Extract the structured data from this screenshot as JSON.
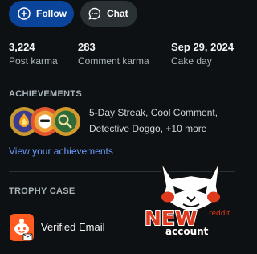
{
  "actions": {
    "follow_label": "Follow",
    "chat_label": "Chat"
  },
  "stats": [
    {
      "value": "3,224",
      "label": "Post karma"
    },
    {
      "value": "283",
      "label": "Comment karma"
    },
    {
      "value": "Sep 29, 2024",
      "label": "Cake day"
    }
  ],
  "achievements": {
    "title": "ACHIEVEMENTS",
    "summary_line1": "5-Day Streak, Cool Comment,",
    "summary_line2": "Detective Doggo, +10 more",
    "link_label": "View your achievements",
    "badge_names": [
      "5-day-streak",
      "cool-comment",
      "detective-doggo"
    ]
  },
  "trophy_case": {
    "title": "TROPHY CASE",
    "items": [
      {
        "label": "Verified Email",
        "icon": "verified-email-trophy-icon"
      }
    ]
  },
  "overlay": {
    "text_main": "NEW",
    "text_small": "reddit",
    "text_sub": "account"
  },
  "colors": {
    "background": "#0e1113",
    "follow_button": "#0a449b",
    "chat_button": "#2a3236",
    "link": "#6a9dff",
    "sticker_red": "#e03a1e"
  }
}
